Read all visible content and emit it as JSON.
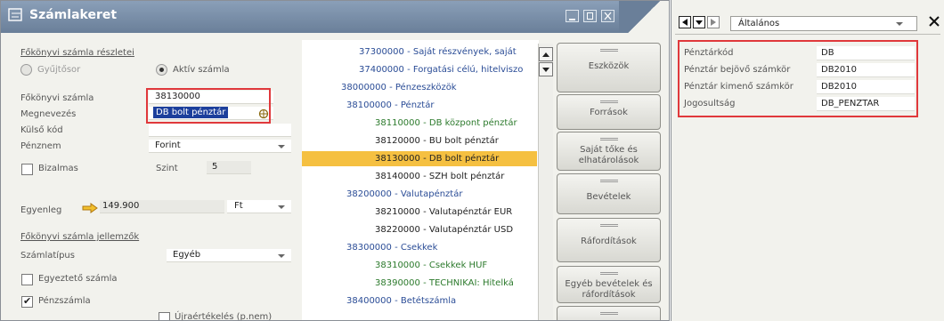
{
  "window": {
    "title": "Számlakeret",
    "buttons": [
      "minimize-button",
      "maximize-button",
      "close-button"
    ]
  },
  "form": {
    "section_details": "Főkönyvi számla részletei",
    "radio_collector": "Gyűjtősor",
    "radio_active": "Aktív számla",
    "account_label": "Főkönyvi számla",
    "account_value": "38130000",
    "name_label": "Megnevezés",
    "name_value": "DB bolt pénztár",
    "external_code_label": "Külső kód",
    "external_code_value": "",
    "currency_label": "Pénznem",
    "currency_value": "Forint",
    "confidential_label": "Bizalmas",
    "confidential_checked": false,
    "level_label": "Szint",
    "level_value": "5",
    "balance_label": "Egyenleg",
    "balance_value": "149.900",
    "balance_currency": "Ft",
    "section_properties": "Főkönyvi számla jellemzők",
    "account_type_label": "Számlatípus",
    "account_type_value": "Egyéb",
    "reconcile_label": "Egyeztető számla",
    "reconcile_checked": false,
    "cash_label": "Pénzszámla",
    "cash_checked": true,
    "revaluation_label": "Újraértékelés (p.nem)",
    "revaluation_checked": false
  },
  "tree": {
    "items": [
      {
        "text": "37300000 - Saját részvények, saját",
        "color": "#2a4c96",
        "selected": false
      },
      {
        "text": "37400000 - Forgatási célú, hitelviszo",
        "color": "#2a4c96",
        "selected": false
      },
      {
        "text": "38000000 - Pénzeszközök",
        "color": "#2a4c96",
        "selected": false
      },
      {
        "text": "38100000 - Pénztár",
        "color": "#2a4c96",
        "selected": false
      },
      {
        "text": "38110000 - DB központ pénztár",
        "color": "#2c7a2c",
        "selected": false
      },
      {
        "text": "38120000 - BU bolt pénztár",
        "color": "#222222",
        "selected": false
      },
      {
        "text": "38130000 - DB bolt pénztár",
        "color": "#222222",
        "selected": true
      },
      {
        "text": "38140000 - SZH bolt pénztár",
        "color": "#222222",
        "selected": false
      },
      {
        "text": "38200000 - Valutapénztár",
        "color": "#2a4c96",
        "selected": false
      },
      {
        "text": "38210000 - Valutapénztár EUR",
        "color": "#222222",
        "selected": false
      },
      {
        "text": "38220000 - Valutapénztár USD",
        "color": "#222222",
        "selected": false
      },
      {
        "text": "38300000 - Csekkek",
        "color": "#2a4c96",
        "selected": false
      },
      {
        "text": "38310000 - Csekkek HUF",
        "color": "#2c7a2c",
        "selected": false
      },
      {
        "text": "38390000 - TECHNIKAI: Hitelká",
        "color": "#2c7a2c",
        "selected": false
      },
      {
        "text": "38400000 - Betétszámla",
        "color": "#2a4c96",
        "selected": false
      }
    ]
  },
  "categories": [
    {
      "label": "Eszközök"
    },
    {
      "label": "Források"
    },
    {
      "label": "Saját tőke és elhatárolások"
    },
    {
      "label": "Bevételek"
    },
    {
      "label": "Ráfordítások"
    },
    {
      "label": "Egyéb bevételek és ráfordítások"
    },
    {
      "label": ""
    }
  ],
  "right_panel": {
    "selector_value": "Általános",
    "rows": [
      {
        "label": "Pénztárkód",
        "value": "DB"
      },
      {
        "label": "Pénztár bejövő számkör",
        "value": "DB2010"
      },
      {
        "label": "Pénztár kimenő számkör",
        "value": "DB2010"
      },
      {
        "label": "Jogosultság",
        "value": "DB_PENZTAR"
      }
    ]
  },
  "colors": {
    "titlebar": "#7a8fa8",
    "selection": "#f5c041",
    "highlight_box": "#e0383b",
    "name_field_selection": "#1c3f9c"
  }
}
